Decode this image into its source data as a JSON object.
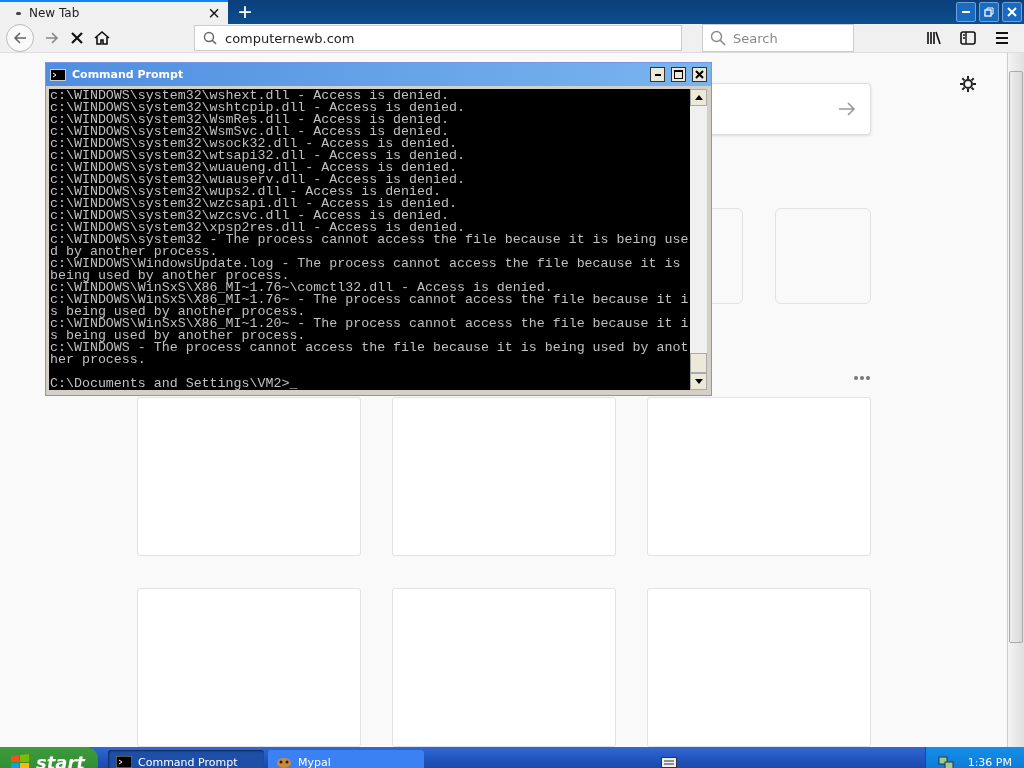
{
  "browser": {
    "tab": {
      "title": "New Tab",
      "close": "×"
    },
    "new_tab": "+",
    "url": "computernewb.com",
    "search": {
      "placeholder": "Search"
    }
  },
  "command_prompt": {
    "title": "Command Prompt",
    "lines": [
      "c:\\WINDOWS\\system32\\wshext.dll - Access is denied.",
      "c:\\WINDOWS\\system32\\wshtcpip.dll - Access is denied.",
      "c:\\WINDOWS\\system32\\WsmRes.dll - Access is denied.",
      "c:\\WINDOWS\\system32\\WsmSvc.dll - Access is denied.",
      "c:\\WINDOWS\\system32\\wsock32.dll - Access is denied.",
      "c:\\WINDOWS\\system32\\wtsapi32.dll - Access is denied.",
      "c:\\WINDOWS\\system32\\wuaueng.dll - Access is denied.",
      "c:\\WINDOWS\\system32\\wuauserv.dll - Access is denied.",
      "c:\\WINDOWS\\system32\\wups2.dll - Access is denied.",
      "c:\\WINDOWS\\system32\\wzcsapi.dll - Access is denied.",
      "c:\\WINDOWS\\system32\\wzcsvc.dll - Access is denied.",
      "c:\\WINDOWS\\system32\\xpsp2res.dll - Access is denied.",
      "c:\\WINDOWS\\system32 - The process cannot access the file because it is being use",
      "d by another process.",
      "c:\\WINDOWS\\WindowsUpdate.log - The process cannot access the file because it is",
      "being used by another process.",
      "c:\\WINDOWS\\WinSxS\\X86_MI~1.76~\\comctl32.dll - Access is denied.",
      "c:\\WINDOWS\\WinSxS\\X86_MI~1.76~ - The process cannot access the file because it i",
      "s being used by another process.",
      "c:\\WINDOWS\\WinSxS\\X86_MI~1.20~ - The process cannot access the file because it i",
      "s being used by another process.",
      "c:\\WINDOWS - The process cannot access the file because it is being used by anot",
      "her process."
    ],
    "prompt": "C:\\Documents and Settings\\VM2>",
    "cursor": "_"
  },
  "taskbar": {
    "start": "start",
    "tasks": [
      {
        "label": "Command Prompt",
        "selected": true
      },
      {
        "label": "Mypal",
        "selected": false
      }
    ],
    "clock": "1:36 PM"
  }
}
